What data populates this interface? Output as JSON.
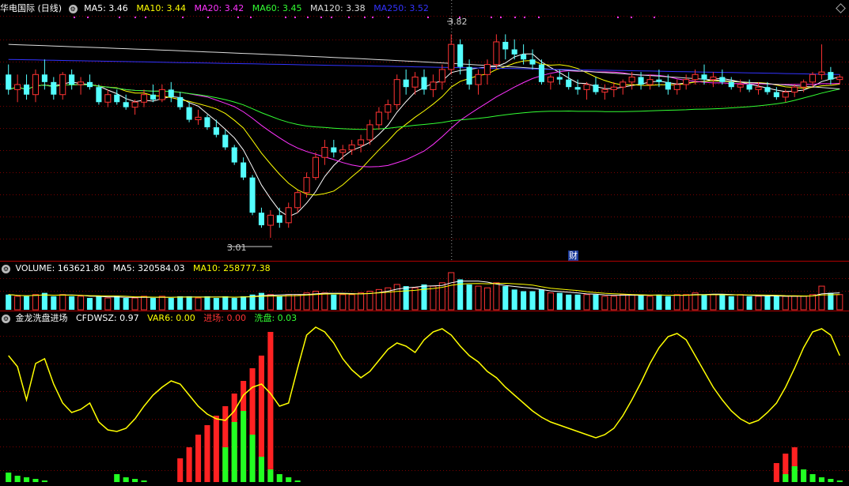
{
  "main": {
    "title": "华电国际 (日线)",
    "indicators": [
      {
        "label": "MA5: 3.46",
        "color": "#ffffff"
      },
      {
        "label": "MA10: 3.44",
        "color": "#ffff00"
      },
      {
        "label": "MA20: 3.42",
        "color": "#ff33ff"
      },
      {
        "label": "MA60: 3.45",
        "color": "#33ff33"
      },
      {
        "label": "MA120: 3.38",
        "color": "#dddddd"
      },
      {
        "label": "MA250: 3.52",
        "color": "#3333ff"
      }
    ],
    "high_label": "3.82",
    "low_label": "3.01",
    "finance_marker": "财"
  },
  "volume": {
    "title": "VOLUME: 163621.80",
    "indicators": [
      {
        "label": "MA5: 320584.03",
        "color": "#ffffff"
      },
      {
        "label": "MA10: 258777.38",
        "color": "#ffff00"
      }
    ]
  },
  "indicator": {
    "title": "金龙洗盘进场",
    "indicators": [
      {
        "label": "CFDWSZ: 0.97",
        "color": "#ffffff"
      },
      {
        "label": "VAR6: 0.00",
        "color": "#ffff00"
      },
      {
        "label": "进场: 0.00",
        "color": "#ff3333"
      },
      {
        "label": "洗盘: 0.03",
        "color": "#33ff33"
      }
    ]
  },
  "colors": {
    "up": "#ff3333",
    "down": "#54ffff",
    "grid": "#7a0000",
    "separator": "#b00000"
  },
  "chart_data": [
    {
      "type": "candlestick",
      "title": "华电国际 (日线)",
      "ylim": [
        2.95,
        3.9
      ],
      "grid": true,
      "candles": [
        [
          3.66,
          3.7,
          3.58,
          3.6
        ],
        [
          3.6,
          3.66,
          3.55,
          3.62
        ],
        [
          3.62,
          3.66,
          3.56,
          3.58
        ],
        [
          3.58,
          3.68,
          3.55,
          3.66
        ],
        [
          3.66,
          3.72,
          3.6,
          3.63
        ],
        [
          3.63,
          3.65,
          3.56,
          3.58
        ],
        [
          3.58,
          3.67,
          3.56,
          3.66
        ],
        [
          3.66,
          3.68,
          3.6,
          3.62
        ],
        [
          3.62,
          3.65,
          3.58,
          3.63
        ],
        [
          3.63,
          3.66,
          3.6,
          3.61
        ],
        [
          3.61,
          3.62,
          3.54,
          3.55
        ],
        [
          3.55,
          3.6,
          3.53,
          3.58
        ],
        [
          3.58,
          3.6,
          3.54,
          3.55
        ],
        [
          3.55,
          3.58,
          3.52,
          3.53
        ],
        [
          3.53,
          3.56,
          3.5,
          3.55
        ],
        [
          3.55,
          3.6,
          3.53,
          3.58
        ],
        [
          3.58,
          3.62,
          3.55,
          3.56
        ],
        [
          3.56,
          3.62,
          3.55,
          3.6
        ],
        [
          3.6,
          3.63,
          3.55,
          3.57
        ],
        [
          3.57,
          3.59,
          3.52,
          3.53
        ],
        [
          3.53,
          3.55,
          3.47,
          3.48
        ],
        [
          3.48,
          3.52,
          3.46,
          3.49
        ],
        [
          3.49,
          3.5,
          3.44,
          3.45
        ],
        [
          3.45,
          3.48,
          3.41,
          3.42
        ],
        [
          3.42,
          3.44,
          3.36,
          3.37
        ],
        [
          3.37,
          3.38,
          3.3,
          3.31
        ],
        [
          3.31,
          3.33,
          3.24,
          3.25
        ],
        [
          3.25,
          3.26,
          3.1,
          3.11
        ],
        [
          3.11,
          3.13,
          3.05,
          3.06
        ],
        [
          3.06,
          3.12,
          3.01,
          3.1
        ],
        [
          3.1,
          3.13,
          3.05,
          3.07
        ],
        [
          3.07,
          3.15,
          3.05,
          3.13
        ],
        [
          3.13,
          3.2,
          3.11,
          3.19
        ],
        [
          3.19,
          3.27,
          3.17,
          3.25
        ],
        [
          3.25,
          3.35,
          3.24,
          3.33
        ],
        [
          3.33,
          3.4,
          3.3,
          3.37
        ],
        [
          3.37,
          3.4,
          3.33,
          3.35
        ],
        [
          3.35,
          3.38,
          3.32,
          3.36
        ],
        [
          3.36,
          3.4,
          3.34,
          3.38
        ],
        [
          3.38,
          3.42,
          3.35,
          3.4
        ],
        [
          3.4,
          3.48,
          3.38,
          3.46
        ],
        [
          3.46,
          3.53,
          3.44,
          3.51
        ],
        [
          3.51,
          3.56,
          3.48,
          3.54
        ],
        [
          3.54,
          3.66,
          3.52,
          3.64
        ],
        [
          3.64,
          3.68,
          3.58,
          3.61
        ],
        [
          3.61,
          3.67,
          3.58,
          3.65
        ],
        [
          3.65,
          3.68,
          3.58,
          3.6
        ],
        [
          3.6,
          3.66,
          3.57,
          3.63
        ],
        [
          3.63,
          3.7,
          3.6,
          3.68
        ],
        [
          3.68,
          3.82,
          3.66,
          3.78
        ],
        [
          3.78,
          3.8,
          3.66,
          3.69
        ],
        [
          3.69,
          3.72,
          3.6,
          3.62
        ],
        [
          3.62,
          3.68,
          3.58,
          3.66
        ],
        [
          3.66,
          3.72,
          3.62,
          3.7
        ],
        [
          3.7,
          3.82,
          3.68,
          3.79
        ],
        [
          3.79,
          3.82,
          3.72,
          3.76
        ],
        [
          3.76,
          3.8,
          3.72,
          3.74
        ],
        [
          3.74,
          3.78,
          3.7,
          3.72
        ],
        [
          3.72,
          3.76,
          3.68,
          3.7
        ],
        [
          3.7,
          3.72,
          3.62,
          3.63
        ],
        [
          3.63,
          3.66,
          3.6,
          3.65
        ],
        [
          3.65,
          3.68,
          3.62,
          3.64
        ],
        [
          3.64,
          3.67,
          3.6,
          3.61
        ],
        [
          3.61,
          3.64,
          3.58,
          3.6
        ],
        [
          3.6,
          3.63,
          3.56,
          3.62
        ],
        [
          3.62,
          3.65,
          3.58,
          3.59
        ],
        [
          3.59,
          3.62,
          3.56,
          3.6
        ],
        [
          3.6,
          3.63,
          3.57,
          3.61
        ],
        [
          3.61,
          3.64,
          3.58,
          3.63
        ],
        [
          3.63,
          3.67,
          3.6,
          3.65
        ],
        [
          3.65,
          3.67,
          3.6,
          3.62
        ],
        [
          3.62,
          3.66,
          3.6,
          3.64
        ],
        [
          3.64,
          3.68,
          3.61,
          3.63
        ],
        [
          3.63,
          3.66,
          3.58,
          3.6
        ],
        [
          3.6,
          3.64,
          3.58,
          3.62
        ],
        [
          3.62,
          3.66,
          3.6,
          3.64
        ],
        [
          3.64,
          3.68,
          3.62,
          3.66
        ],
        [
          3.66,
          3.7,
          3.62,
          3.64
        ],
        [
          3.64,
          3.67,
          3.61,
          3.65
        ],
        [
          3.65,
          3.68,
          3.62,
          3.63
        ],
        [
          3.63,
          3.65,
          3.6,
          3.61
        ],
        [
          3.61,
          3.64,
          3.59,
          3.62
        ],
        [
          3.62,
          3.64,
          3.59,
          3.6
        ],
        [
          3.6,
          3.63,
          3.58,
          3.61
        ],
        [
          3.61,
          3.63,
          3.58,
          3.59
        ],
        [
          3.59,
          3.61,
          3.56,
          3.57
        ],
        [
          3.57,
          3.6,
          3.55,
          3.59
        ],
        [
          3.59,
          3.62,
          3.57,
          3.61
        ],
        [
          3.61,
          3.64,
          3.59,
          3.63
        ],
        [
          3.63,
          3.67,
          3.61,
          3.66
        ],
        [
          3.66,
          3.78,
          3.64,
          3.67
        ],
        [
          3.67,
          3.69,
          3.62,
          3.64
        ],
        [
          3.64,
          3.66,
          3.62,
          3.65
        ]
      ],
      "series": [
        {
          "name": "MA5",
          "color": "#ffffff"
        },
        {
          "name": "MA10",
          "color": "#ffff00"
        },
        {
          "name": "MA20",
          "color": "#ff33ff"
        },
        {
          "name": "MA60",
          "color": "#33ff33"
        },
        {
          "name": "MA120",
          "color": "#dddddd"
        },
        {
          "name": "MA250",
          "color": "#3333ff"
        }
      ]
    },
    {
      "type": "bar",
      "title": "VOLUME",
      "values": [
        9,
        8,
        8,
        9,
        10,
        8,
        9,
        8,
        8,
        7,
        8,
        7,
        8,
        7,
        7,
        8,
        7,
        8,
        7,
        8,
        8,
        7,
        8,
        7,
        8,
        7,
        8,
        9,
        10,
        9,
        8,
        9,
        9,
        10,
        11,
        10,
        9,
        9,
        9,
        10,
        11,
        12,
        13,
        15,
        14,
        13,
        15,
        14,
        16,
        22,
        18,
        15,
        14,
        13,
        16,
        14,
        12,
        11,
        11,
        12,
        10,
        10,
        9,
        9,
        9,
        9,
        8,
        8,
        9,
        9,
        9,
        8,
        9,
        8,
        9,
        9,
        10,
        9,
        9,
        9,
        8,
        9,
        8,
        8,
        8,
        8,
        8,
        8,
        8,
        9,
        14,
        10,
        9
      ]
    },
    {
      "type": "bar",
      "title": "金龙洗盘进场",
      "ylim": [
        0,
        1
      ],
      "series": [
        {
          "name": "CFDWSZ",
          "color": "#ffff00",
          "values": [
            0.8,
            0.73,
            0.52,
            0.75,
            0.78,
            0.62,
            0.5,
            0.44,
            0.46,
            0.5,
            0.38,
            0.33,
            0.32,
            0.34,
            0.4,
            0.48,
            0.55,
            0.6,
            0.64,
            0.62,
            0.55,
            0.48,
            0.43,
            0.4,
            0.39,
            0.45,
            0.55,
            0.6,
            0.62,
            0.56,
            0.48,
            0.5,
            0.72,
            0.93,
            0.98,
            0.95,
            0.88,
            0.78,
            0.71,
            0.66,
            0.7,
            0.77,
            0.84,
            0.88,
            0.86,
            0.82,
            0.9,
            0.95,
            0.97,
            0.93,
            0.86,
            0.8,
            0.76,
            0.7,
            0.66,
            0.6,
            0.55,
            0.5,
            0.45,
            0.41,
            0.38,
            0.36,
            0.34,
            0.32,
            0.3,
            0.28,
            0.3,
            0.34,
            0.42,
            0.52,
            0.63,
            0.75,
            0.85,
            0.92,
            0.94,
            0.9,
            0.8,
            0.7,
            0.6,
            0.52,
            0.45,
            0.4,
            0.37,
            0.39,
            0.44,
            0.5,
            0.6,
            0.72,
            0.85,
            0.95,
            0.97,
            0.93,
            0.8
          ]
        },
        {
          "name": "进场",
          "color": "#ff2222",
          "values": [
            0,
            0,
            0,
            0,
            0,
            0,
            0,
            0,
            0,
            0,
            0,
            0,
            0,
            0,
            0,
            0,
            0,
            0,
            0,
            0.15,
            0.22,
            0.3,
            0.36,
            0.42,
            0.48,
            0.56,
            0.64,
            0.72,
            0.8,
            0.95,
            0,
            0,
            0,
            0,
            0,
            0,
            0,
            0,
            0,
            0,
            0,
            0,
            0,
            0,
            0,
            0,
            0,
            0,
            0,
            0,
            0,
            0,
            0,
            0,
            0,
            0,
            0,
            0,
            0,
            0,
            0,
            0,
            0,
            0,
            0,
            0,
            0,
            0,
            0,
            0,
            0,
            0,
            0,
            0,
            0,
            0,
            0,
            0,
            0,
            0,
            0,
            0,
            0,
            0,
            0,
            0.12,
            0.18,
            0.22,
            0,
            0,
            0,
            0,
            0
          ]
        },
        {
          "name": "洗盘",
          "color": "#22ff22",
          "values": [
            0.06,
            0.04,
            0.03,
            0.02,
            0.01,
            0,
            0,
            0,
            0,
            0,
            0,
            0,
            0.05,
            0.03,
            0.02,
            0.01,
            0,
            0,
            0,
            0,
            0,
            0,
            0,
            0,
            0.22,
            0.38,
            0.45,
            0.3,
            0.16,
            0.08,
            0.05,
            0.03,
            0.01,
            0,
            0,
            0,
            0,
            0,
            0,
            0,
            0,
            0,
            0,
            0,
            0,
            0,
            0,
            0,
            0,
            0,
            0,
            0,
            0,
            0,
            0,
            0,
            0,
            0,
            0,
            0,
            0,
            0,
            0,
            0,
            0,
            0,
            0,
            0,
            0,
            0,
            0,
            0,
            0,
            0,
            0,
            0,
            0,
            0,
            0,
            0,
            0,
            0,
            0,
            0,
            0,
            0,
            0.05,
            0.1,
            0.08,
            0.05,
            0.03,
            0.02,
            0.01
          ]
        }
      ]
    }
  ]
}
